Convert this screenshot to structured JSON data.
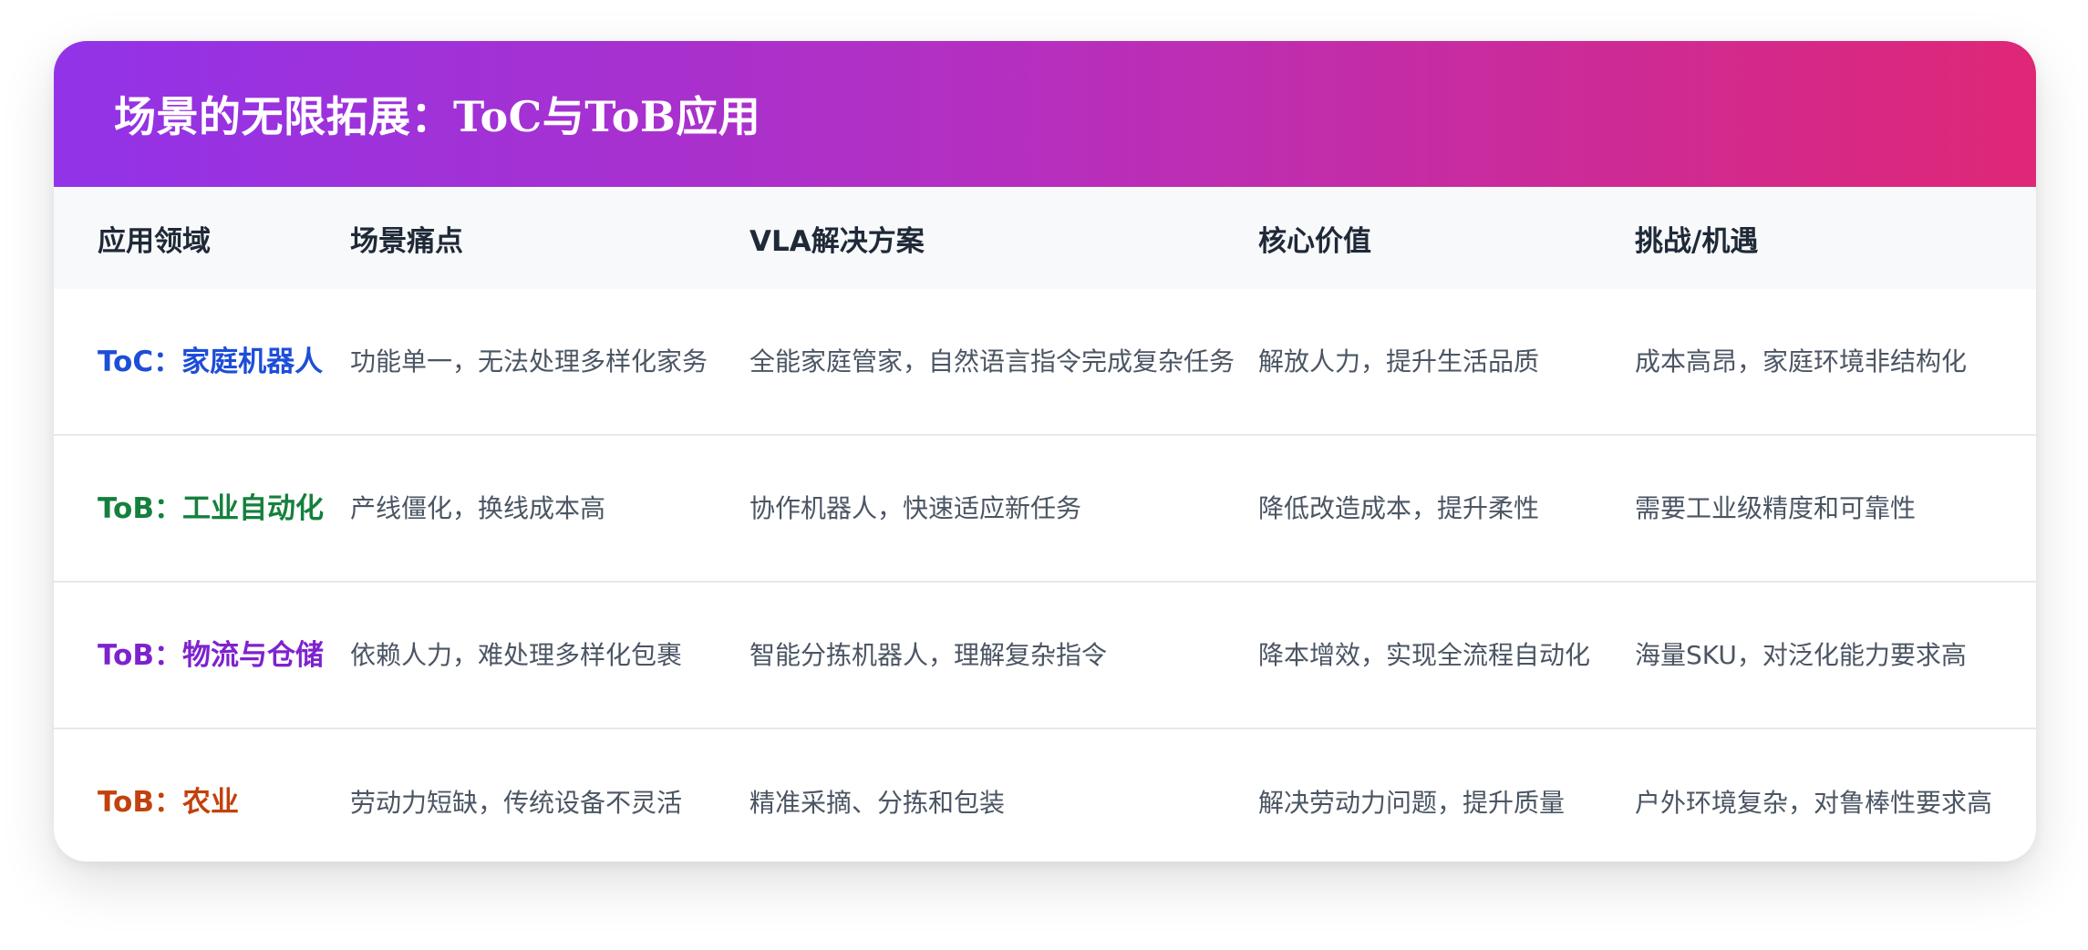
{
  "title": "场景的无限拓展：ToC与ToB应用",
  "table": {
    "headers": [
      "应用领域",
      "场景痛点",
      "VLA解决方案",
      "核心价值",
      "挑战/机遇"
    ],
    "rows": [
      {
        "domain": "ToC：家庭机器人",
        "domain_color": "#1d4ed8",
        "pain": "功能单一，无法处理多样化家务",
        "solution": "全能家庭管家，自然语言指令完成复杂任务",
        "value": "解放人力，提升生活品质",
        "challenge": "成本高昂，家庭环境非结构化"
      },
      {
        "domain": "ToB：工业自动化",
        "domain_color": "#15803d",
        "pain": "产线僵化，换线成本高",
        "solution": "协作机器人，快速适应新任务",
        "value": "降低改造成本，提升柔性",
        "challenge": "需要工业级精度和可靠性"
      },
      {
        "domain": "ToB：物流与仓储",
        "domain_color": "#7e22ce",
        "pain": "依赖人力，难处理多样化包裹",
        "solution": "智能分拣机器人，理解复杂指令",
        "value": "降本增效，实现全流程自动化",
        "challenge": "海量SKU，对泛化能力要求高"
      },
      {
        "domain": "ToB：农业",
        "domain_color": "#c2410c",
        "pain": "劳动力短缺，传统设备不灵活",
        "solution": "精准采摘、分拣和包装",
        "value": "解决劳动力问题，提升质量",
        "challenge": "户外环境复杂，对鲁棒性要求高"
      }
    ]
  }
}
